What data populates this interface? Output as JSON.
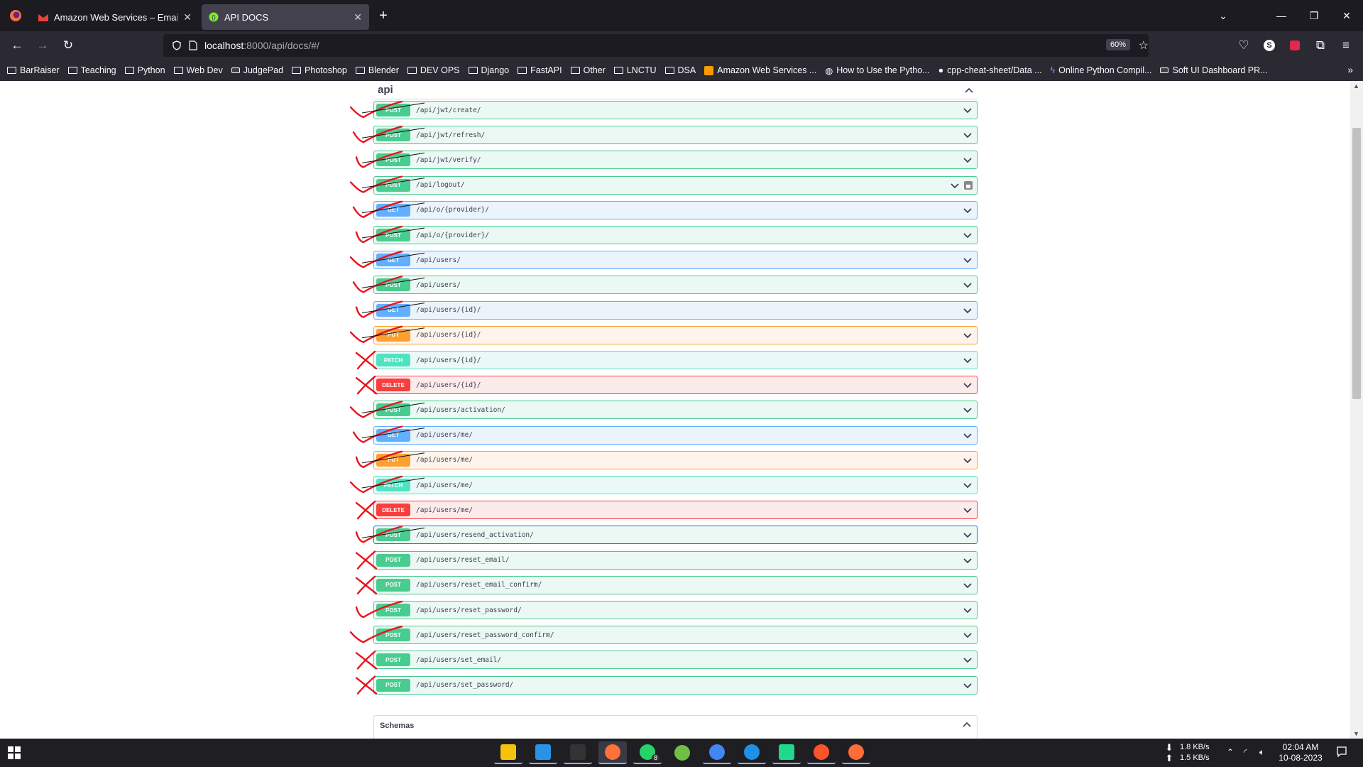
{
  "browser": {
    "tabs": [
      {
        "title": "Amazon Web Services – Email A",
        "icon": "gmail-icon",
        "active": false
      },
      {
        "title": "API DOCS",
        "icon": "swagger-icon",
        "active": true
      }
    ],
    "url_host": "localhost",
    "url_path": ":8000/api/docs/#/",
    "zoom": "60%",
    "bookmarks": [
      {
        "label": "BarRaiser",
        "icon": "folder-icon"
      },
      {
        "label": "Teaching",
        "icon": "folder-icon"
      },
      {
        "label": "Python",
        "icon": "folder-icon"
      },
      {
        "label": "Web Dev",
        "icon": "folder-icon"
      },
      {
        "label": "JudgePad",
        "icon": "site-icon"
      },
      {
        "label": "Photoshop",
        "icon": "folder-icon"
      },
      {
        "label": "Blender",
        "icon": "folder-icon"
      },
      {
        "label": "DEV OPS",
        "icon": "folder-icon"
      },
      {
        "label": "Django",
        "icon": "folder-icon"
      },
      {
        "label": "FastAPI",
        "icon": "folder-icon"
      },
      {
        "label": "Other",
        "icon": "folder-icon"
      },
      {
        "label": "LNCTU",
        "icon": "folder-icon"
      },
      {
        "label": "DSA",
        "icon": "folder-icon"
      },
      {
        "label": "Amazon Web Services ...",
        "icon": "aws-icon"
      },
      {
        "label": "How to Use the Pytho...",
        "icon": "globe-icon"
      },
      {
        "label": "cpp-cheat-sheet/Data ...",
        "icon": "github-icon"
      },
      {
        "label": "Online Python Compil...",
        "icon": "bolt-icon"
      },
      {
        "label": "Soft UI Dashboard PR...",
        "icon": "site-icon"
      }
    ]
  },
  "page": {
    "section_title": "api",
    "operations": [
      {
        "method": "POST",
        "path": "/api/jwt/create/",
        "kind": "post",
        "mark": "check"
      },
      {
        "method": "POST",
        "path": "/api/jwt/refresh/",
        "kind": "post",
        "mark": "check"
      },
      {
        "method": "POST",
        "path": "/api/jwt/verify/",
        "kind": "post",
        "mark": "check"
      },
      {
        "method": "POST",
        "path": "/api/logout/",
        "kind": "post",
        "mark": "check",
        "lock": true
      },
      {
        "method": "GET",
        "path": "/api/o/{provider}/",
        "kind": "get",
        "mark": "check"
      },
      {
        "method": "POST",
        "path": "/api/o/{provider}/",
        "kind": "post",
        "mark": "check"
      },
      {
        "method": "GET",
        "path": "/api/users/",
        "kind": "get",
        "mark": "check"
      },
      {
        "method": "POST",
        "path": "/api/users/",
        "kind": "post",
        "mark": "check"
      },
      {
        "method": "GET",
        "path": "/api/users/{id}/",
        "kind": "get",
        "mark": "check"
      },
      {
        "method": "PUT",
        "path": "/api/users/{id}/",
        "kind": "put",
        "mark": "check"
      },
      {
        "method": "PATCH",
        "path": "/api/users/{id}/",
        "kind": "patch",
        "mark": "cross"
      },
      {
        "method": "DELETE",
        "path": "/api/users/{id}/",
        "kind": "delete",
        "mark": "cross"
      },
      {
        "method": "POST",
        "path": "/api/users/activation/",
        "kind": "post",
        "mark": "check"
      },
      {
        "method": "GET",
        "path": "/api/users/me/",
        "kind": "get",
        "mark": "check"
      },
      {
        "method": "PUT",
        "path": "/api/users/me/",
        "kind": "put",
        "mark": "check"
      },
      {
        "method": "PATCH",
        "path": "/api/users/me/",
        "kind": "patch",
        "mark": "check"
      },
      {
        "method": "DELETE",
        "path": "/api/users/me/",
        "kind": "delete",
        "mark": "cross"
      },
      {
        "method": "POST",
        "path": "/api/users/resend_activation/",
        "kind": "post",
        "mark": "check",
        "focused": true
      },
      {
        "method": "POST",
        "path": "/api/users/reset_email/",
        "kind": "post",
        "mark": "cross"
      },
      {
        "method": "POST",
        "path": "/api/users/reset_email_confirm/",
        "kind": "post",
        "mark": "cross"
      },
      {
        "method": "POST",
        "path": "/api/users/reset_password/",
        "kind": "post",
        "mark": "check"
      },
      {
        "method": "POST",
        "path": "/api/users/reset_password_confirm/",
        "kind": "post",
        "mark": "check"
      },
      {
        "method": "POST",
        "path": "/api/users/set_email/",
        "kind": "post",
        "mark": "cross"
      },
      {
        "method": "POST",
        "path": "/api/users/set_password/",
        "kind": "post",
        "mark": "cross"
      }
    ],
    "schemas_label": "Schemas"
  },
  "taskbar": {
    "apps": [
      "file-explorer-icon",
      "vscode-icon",
      "terminal-icon",
      "firefox-icon",
      "whatsapp-icon",
      "blender-icon",
      "chrome-icon",
      "docker-icon",
      "pycharm-icon",
      "brave-icon",
      "postman-icon"
    ],
    "whatsapp_badge": "8",
    "net_down": "1.8 KB/s",
    "net_up": "1.5 KB/s",
    "time": "02:04 AM",
    "date": "10-08-2023"
  },
  "colors": {
    "post": "#49cc90",
    "get": "#61affe",
    "put": "#fca130",
    "patch": "#50e3c2",
    "delete": "#f93e3e",
    "annotation": "#e8141c"
  }
}
